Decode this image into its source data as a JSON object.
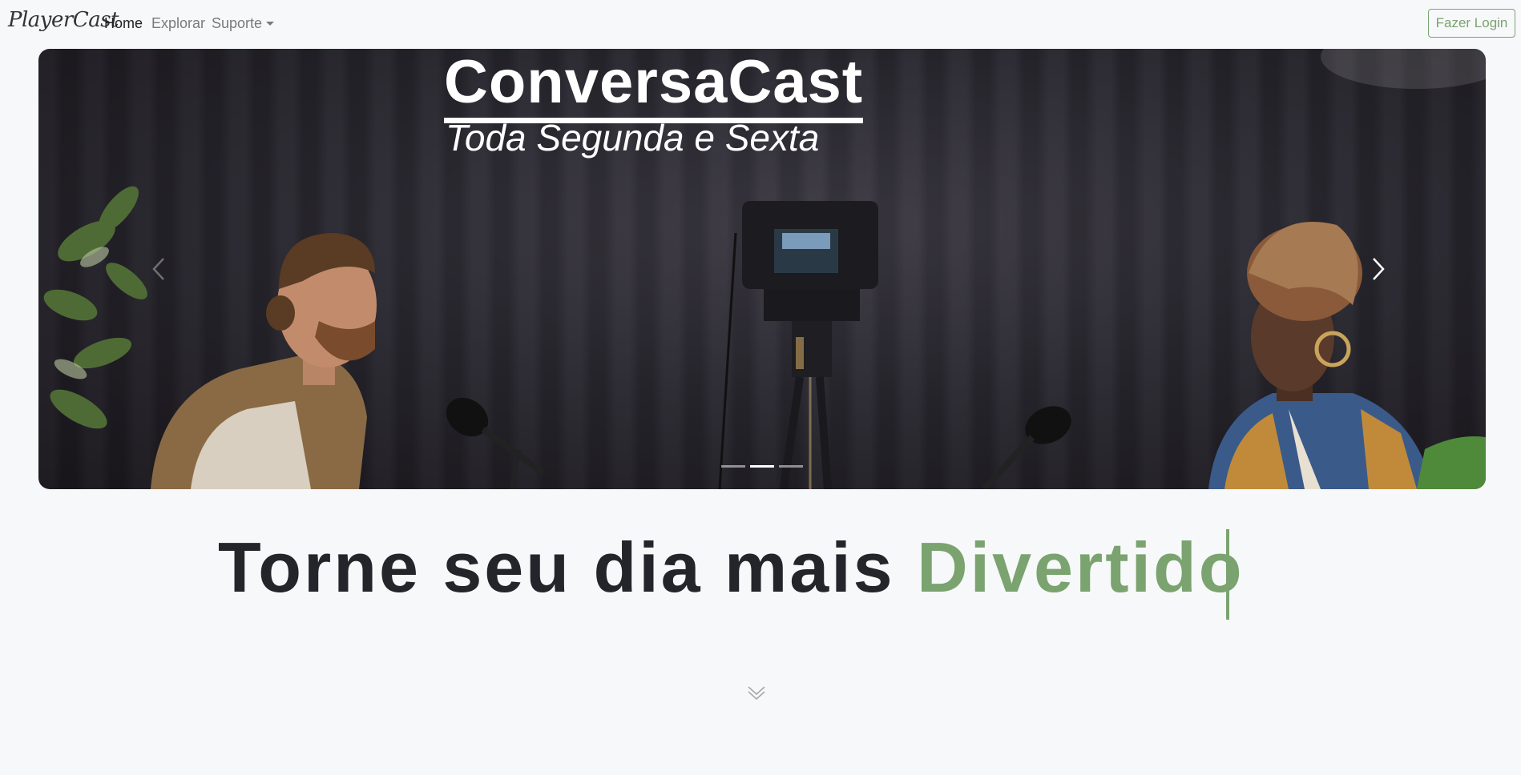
{
  "navbar": {
    "brand": "PlayerCast",
    "links": [
      {
        "label": "Home",
        "active": true
      },
      {
        "label": "Explorar",
        "active": false
      },
      {
        "label": "Suporte",
        "active": false
      }
    ],
    "login_label": "Fazer Login"
  },
  "carousel": {
    "slide_title": "ConversaCast",
    "slide_subtitle": "Toda Segunda e Sexta",
    "indicator_count": 3,
    "active_index": 1,
    "prev_icon": "chevron-left-icon",
    "next_icon": "chevron-right-icon"
  },
  "hero": {
    "headline_prefix": "Torne seu dia mais ",
    "headline_accent": "Divertido"
  },
  "scroll_icon": "chevron-double-down-icon",
  "colors": {
    "accent": "#7aa36f",
    "text_dark": "#23252a",
    "background": "#f7f8f9"
  }
}
